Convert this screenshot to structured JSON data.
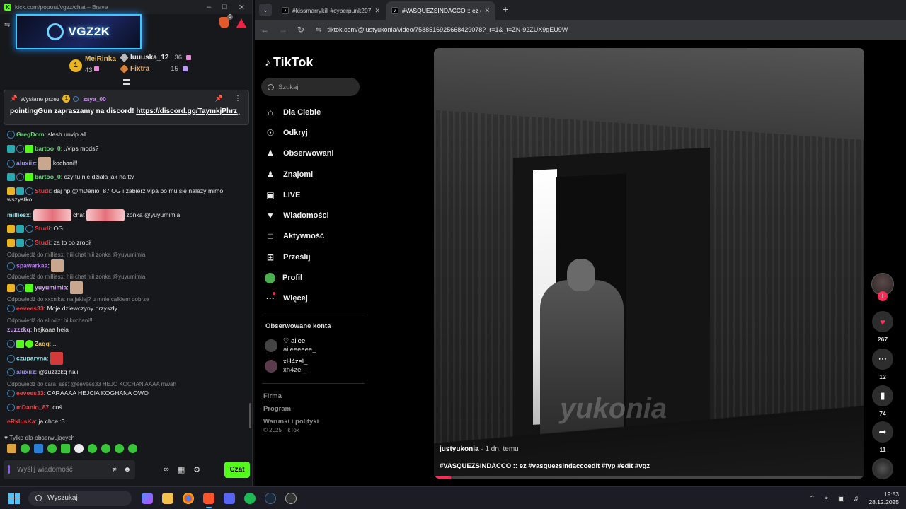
{
  "kick_window": {
    "title": "kick.com/popout/vgzz/chat – Brave",
    "channel_logo_text": "VGZ2K",
    "leaderboard": {
      "first": {
        "rank": "1",
        "name": "MeiRinka",
        "count": "43"
      },
      "second": {
        "name": "luuuska_12",
        "count": "36"
      },
      "third": {
        "name": "Fixtra",
        "count": "15"
      }
    },
    "pinned": {
      "sent_by_label": "Wysłane przez",
      "sender": "zaya_00",
      "message": "pointingGun zapraszamy na discord! ",
      "link": "https://discord.gg/TaymkjPhrz"
    },
    "messages": [
      {
        "user": "GregDom",
        "color": "#6ad17a",
        "text": "slesh unvip all"
      },
      {
        "user": "bartoo_0",
        "color": "#6ad17a",
        "text": "./vips mods?"
      },
      {
        "user": "aluxiiz",
        "color": "#9a8cf0",
        "text": "kochani!!"
      },
      {
        "user": "bartoo_0",
        "color": "#6ad17a",
        "text": "czy tu nie działa jak na ttv"
      },
      {
        "user": "Studi",
        "color": "#e8434a",
        "text": "daj np @mDanio_87 OG i zabierz vipa bo mu się należy mimo wszystko"
      },
      {
        "user": "milliesx",
        "color": "#8fe3e8",
        "text": "chat",
        "text2": "zonka @yuyumimia"
      },
      {
        "user": "Studi",
        "color": "#e8434a",
        "text": "OG"
      },
      {
        "user": "Studi",
        "color": "#e8434a",
        "text": "za to co zrobił"
      },
      {
        "reply": "Odpowiedź do milliesx: hiii chat hiii zonka @yuyumimia",
        "user": "spawarkaa",
        "color": "#b57cf0",
        "text": ""
      },
      {
        "reply": "Odpowiedź do milliesx: hiii chat hiii zonka @yuyumimia",
        "user": "yuyumimia",
        "color": "#d6a9f5",
        "text": ""
      },
      {
        "reply": "Odpowiedź do xxxnika: na jakiej? u mnie całkiem dobrze",
        "user": "eevees33",
        "color": "#e8434a",
        "text": "Moje dziewczyny przyszły"
      },
      {
        "reply": "Odpowiedź do aluxiiz: hi kochani!!",
        "user": "zuzzzkq",
        "color": "#d6a9f5",
        "text": "hejkaaa heja"
      },
      {
        "user": "Zaqq",
        "color": "#e8c04a",
        "text": "..."
      },
      {
        "user": "czuparyna",
        "color": "#8fe3e8",
        "text": ""
      },
      {
        "user": "aluxiiz",
        "color": "#9a8cf0",
        "text": "@zuzzzkq haii"
      },
      {
        "reply": "Odpowiedź do cara_sss: @eevees33 HEJO KOCHAN AAAA mwah",
        "user": "eevees33",
        "color": "#e8434a",
        "text": "CARAAAA HEJCIA KOGHANA OWO"
      },
      {
        "user": "mDanio_87",
        "color": "#e8434a",
        "text": "coś"
      },
      {
        "user": "eRklusKa",
        "color": "#e8434a",
        "text": "ja chce :3"
      }
    ],
    "followers_only": "Tylko dla obserwujących",
    "input_placeholder": "Wyślij wiadomość",
    "send_label": "Czat"
  },
  "browser": {
    "tabs": [
      {
        "title": "#kissmarrykill #cyberpunk2077",
        "active": false
      },
      {
        "title": "#VASQUEZSINDACCO :: ez #vasq",
        "active": true
      }
    ],
    "url": "tiktok.com/@justyukonia/video/7588516925668429078?_r=1&_t=ZN-92ZUX9gEU9W"
  },
  "tiktok": {
    "logo": "TikTok",
    "search_placeholder": "Szukaj",
    "nav": [
      {
        "label": "Dla Ciebie",
        "icon": "home-icon"
      },
      {
        "label": "Odkryj",
        "icon": "compass-icon"
      },
      {
        "label": "Obserwowani",
        "icon": "user-follow-icon"
      },
      {
        "label": "Znajomi",
        "icon": "friends-icon"
      },
      {
        "label": "LIVE",
        "icon": "live-icon"
      },
      {
        "label": "Wiadomości",
        "icon": "paper-plane-icon"
      },
      {
        "label": "Aktywność",
        "icon": "activity-icon"
      },
      {
        "label": "Prześlij",
        "icon": "upload-icon"
      },
      {
        "label": "Profil",
        "icon": "profile-avatar"
      },
      {
        "label": "Więcej",
        "icon": "more-icon"
      }
    ],
    "following_title": "Obserwowane konta",
    "following": [
      {
        "name": "♡ ailee",
        "handle": "aileeeeee_"
      },
      {
        "name": "xH4zel_",
        "handle": "xh4zel_"
      }
    ],
    "footer": [
      "Firma",
      "Program",
      "Warunki i polityki"
    ],
    "copyright": "© 2025 TikTok",
    "video": {
      "author": "justyukonia",
      "time_ago": " · 1 dn. temu",
      "description": "#VASQUEZSINDACCO :: ez #vasquezsindaccoedit #fyp #edit #vgz",
      "watermark": "yukonia",
      "progress": 0.04
    },
    "rail": {
      "likes": "267",
      "comments": "12",
      "saves": "74",
      "shares": "11"
    }
  },
  "taskbar": {
    "search_label": "Wyszukaj",
    "time": "19:53",
    "date": "28.12.2025"
  }
}
